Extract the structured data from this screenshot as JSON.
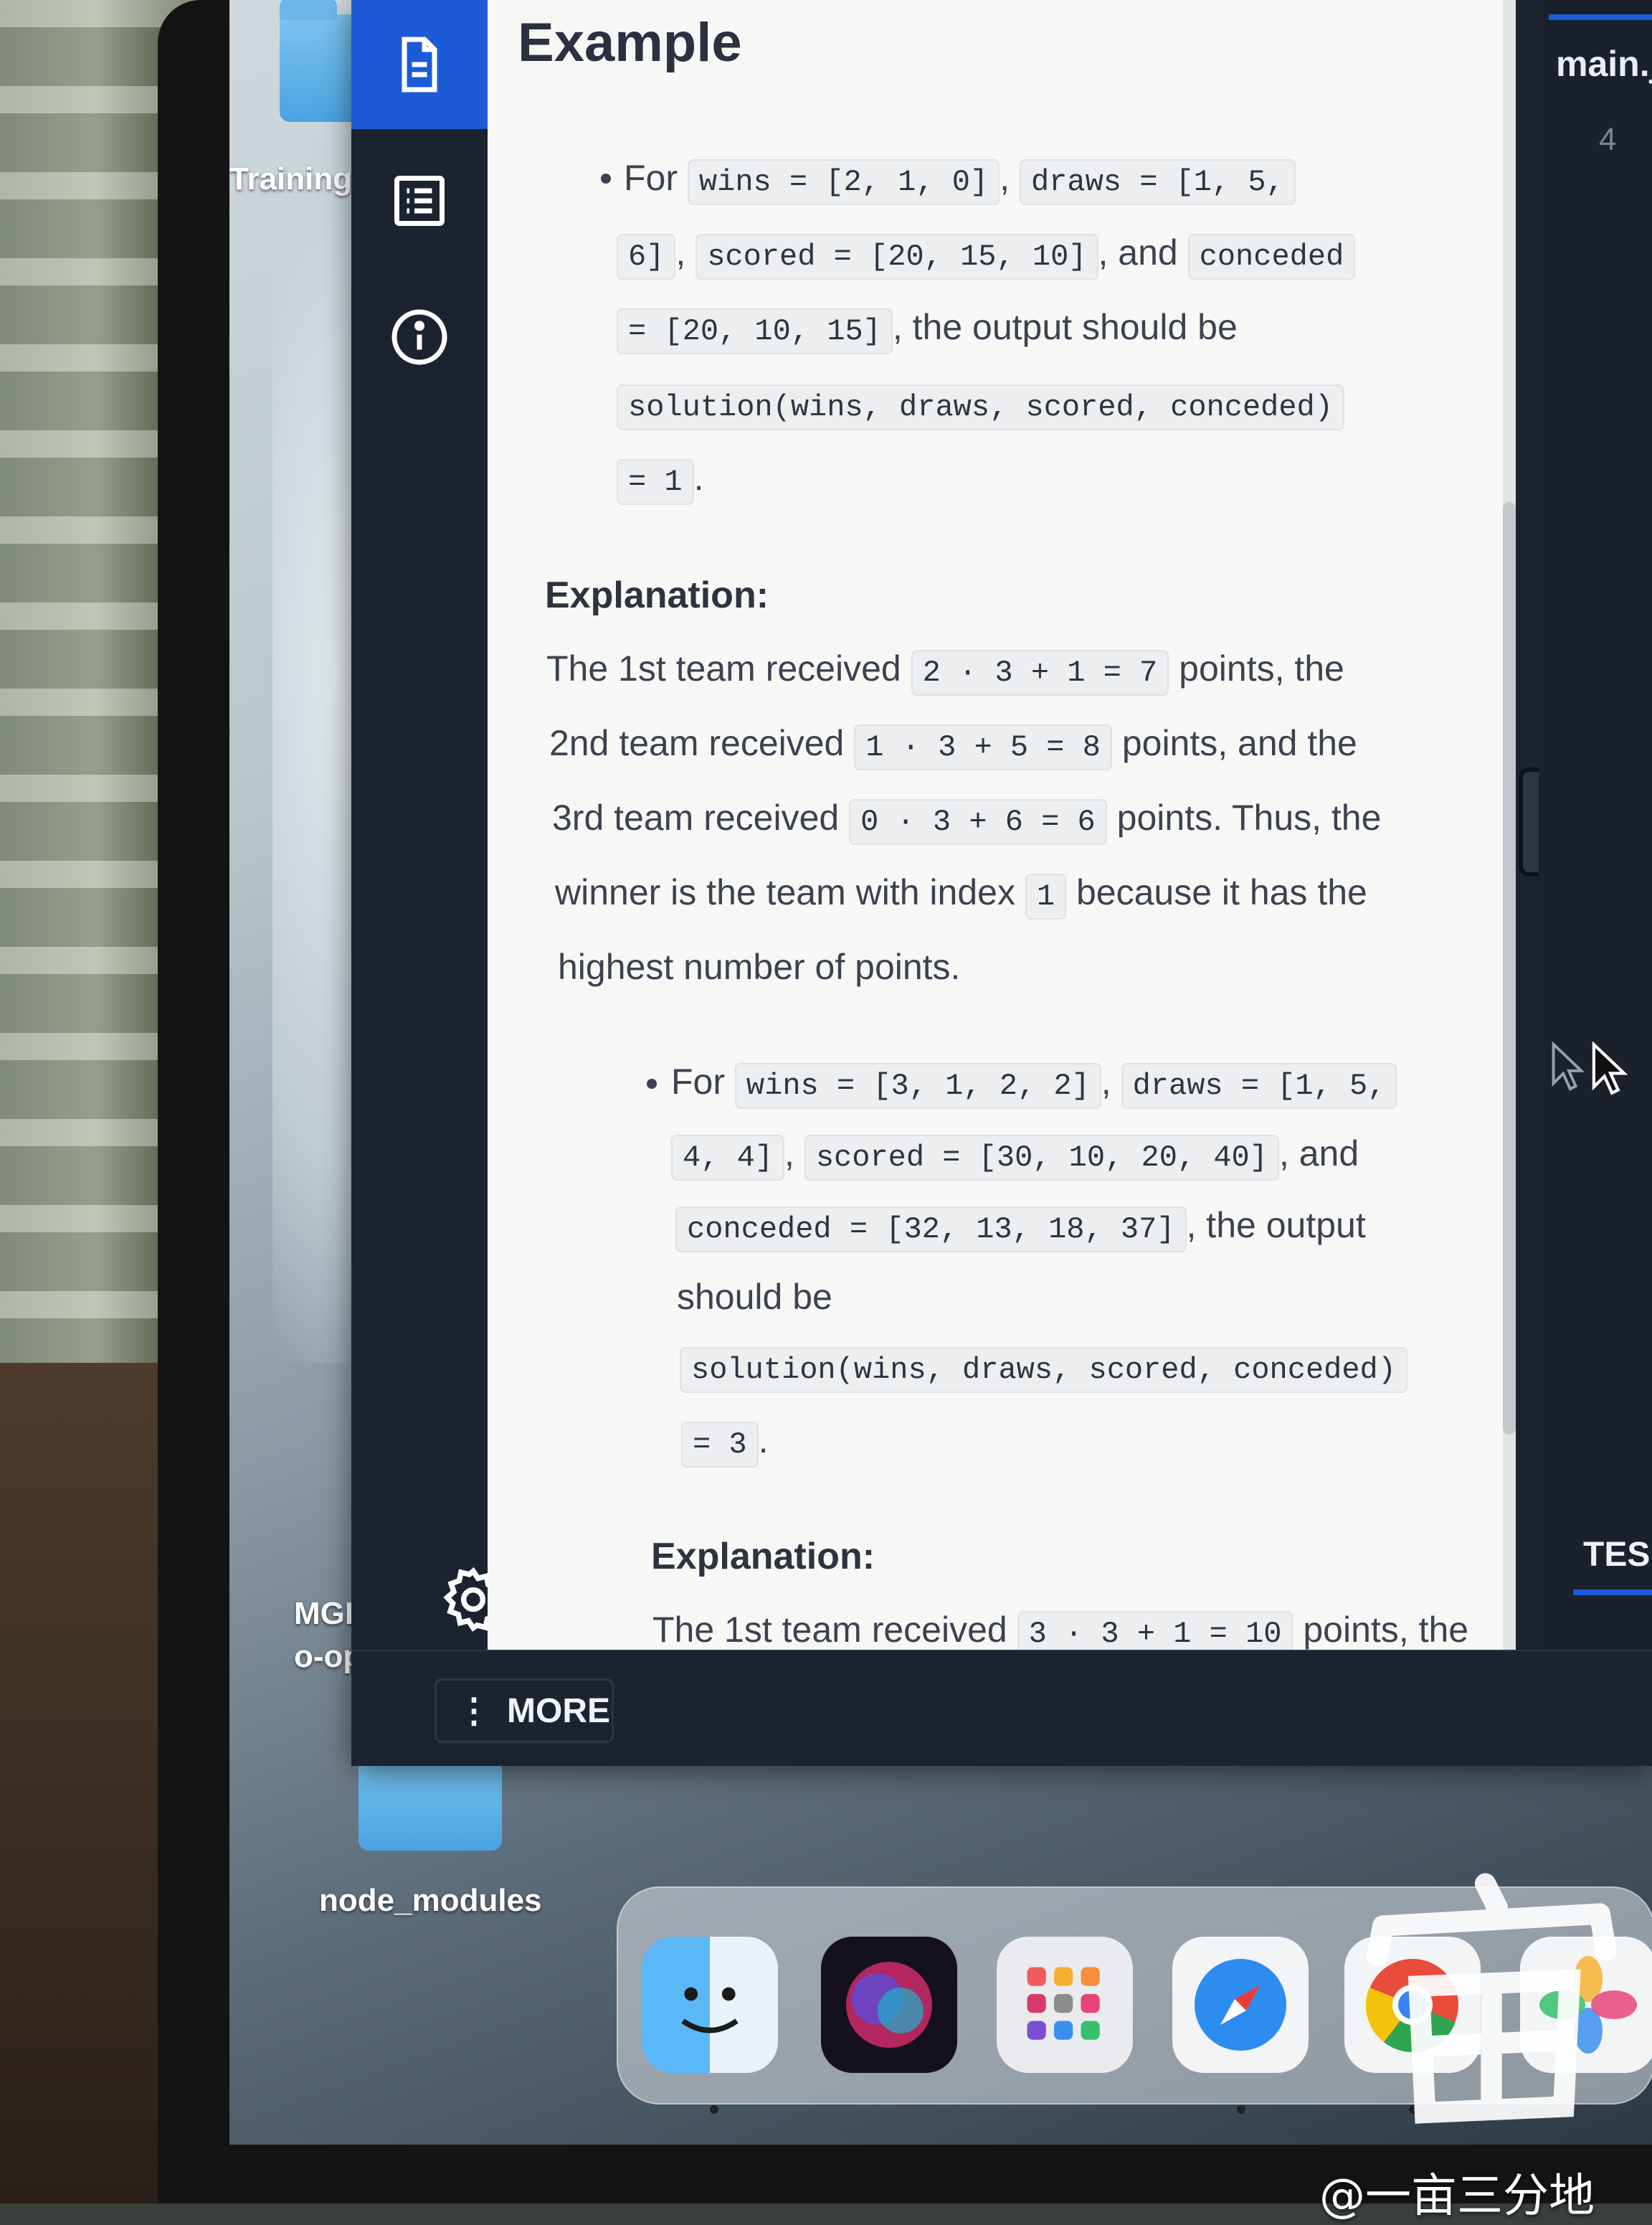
{
  "desktop": {
    "folders": [
      {
        "label": "Training"
      },
      {
        "label": "node_modules"
      }
    ],
    "file_label_lines": [
      "MGEN C",
      "o-op P..."
    ]
  },
  "sidebar": {
    "icons": [
      "document-icon",
      "list-icon",
      "info-icon"
    ],
    "more_label": "MORE"
  },
  "content": {
    "title": "Example",
    "example1": {
      "line1_for": "For",
      "wins": "wins = [2, 1, 0]",
      "draws_a": "draws = [1, 5,",
      "draws_b": "6]",
      "scored": "scored = [20, 15, 10]",
      "and": ", and",
      "conceded_a": "conceded",
      "conceded_b": "= [20, 10, 15]",
      "output_text": ", the output should be",
      "call": "solution(wins, draws, scored, conceded)",
      "result": "= 1",
      "period": "."
    },
    "explanation1": {
      "heading": "Explanation:",
      "t1": "The 1st team received",
      "c1": "2 · 3 + 1 = 7",
      "t1b": "points, the",
      "t2": "2nd team received",
      "c2": "1 · 3 + 5 = 8",
      "t2b": "points, and the",
      "t3": "3rd team received",
      "c3": "0 · 3 + 6 = 6",
      "t3b": "points. Thus, the",
      "t4": "winner is the team with index",
      "c4": "1",
      "t4b": "because it has the",
      "t5": "highest number of points."
    },
    "example2": {
      "line1_for": "For",
      "wins": "wins = [3, 1, 2, 2]",
      "draws_a": "draws = [1, 5,",
      "draws_b": "4, 4]",
      "scored": "scored = [30, 10, 20, 40]",
      "and": ", and",
      "conceded": "conceded = [32, 13, 18, 37]",
      "output_text": ", the output",
      "should_be": "should be",
      "call": "solution(wins, draws, scored, conceded)",
      "result": "= 3",
      "period": "."
    },
    "explanation2": {
      "heading": "Explanation:",
      "t1": "The 1st team received",
      "c1": "3 · 3 + 1 = 10",
      "t1b": "points, the"
    }
  },
  "editor": {
    "tab_label": "main.j",
    "line_number": "4",
    "tests_label": "TES"
  },
  "watermark": {
    "text": "@一亩三分地"
  },
  "dock": {
    "apps": [
      "finder-icon",
      "siri-icon",
      "launchpad-icon",
      "safari-icon",
      "chrome-icon",
      "photos-icon"
    ]
  }
}
